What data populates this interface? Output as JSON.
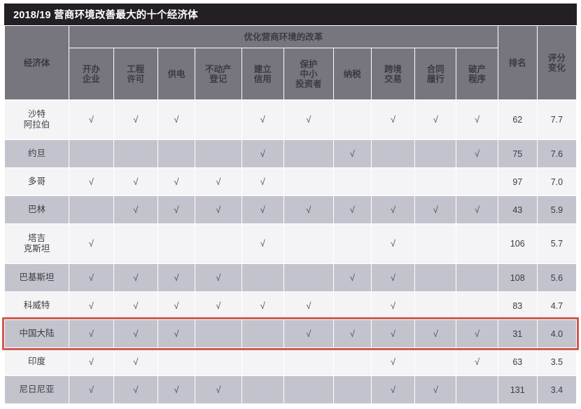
{
  "title": "2018/19 营商环境改善最大的十个经济体",
  "colors": {
    "title_bar_bg": "#231f25",
    "header_bg": "#77767f",
    "row_light_bg": "#f4f4f7",
    "row_dark_bg": "#c3c3cd",
    "highlight_border": "#cd5b52",
    "text": "#3b3b42"
  },
  "header": {
    "economy_label": "经济体",
    "reform_group_label": "优化营商环境的改革",
    "rank_label": "排名",
    "score_change_label": "评分\n变化",
    "score_change_line1": "评分",
    "score_change_line2": "变化",
    "reform_columns": [
      {
        "line1": "开办",
        "line2": "企业",
        "full": "开办企业"
      },
      {
        "line1": "工程",
        "line2": "许可",
        "full": "工程许可"
      },
      {
        "line1": "供电",
        "line2": "",
        "full": "供电"
      },
      {
        "line1": "不动产",
        "line2": "登记",
        "full": "不动产登记"
      },
      {
        "line1": "建立",
        "line2": "信用",
        "full": "建立信用"
      },
      {
        "line1": "保护",
        "line2": "中小",
        "line3": "投资者",
        "full": "保护中小投资者"
      },
      {
        "line1": "纳税",
        "line2": "",
        "full": "纳税"
      },
      {
        "line1": "跨境",
        "line2": "交易",
        "full": "跨境交易"
      },
      {
        "line1": "合同",
        "line2": "履行",
        "full": "合同履行"
      },
      {
        "line1": "破产",
        "line2": "程序",
        "full": "破产程序"
      }
    ]
  },
  "check_mark": "√",
  "rows": [
    {
      "name_lines": [
        "沙特",
        "阿拉伯"
      ],
      "name": "沙特阿拉伯",
      "reforms": [
        true,
        true,
        true,
        false,
        true,
        true,
        false,
        true,
        true,
        true
      ],
      "rank": "62",
      "score_change": "7.7",
      "shade": "light",
      "tall": true,
      "highlighted": false
    },
    {
      "name_lines": [
        "约旦"
      ],
      "name": "约旦",
      "reforms": [
        false,
        false,
        false,
        false,
        true,
        false,
        true,
        false,
        false,
        true
      ],
      "rank": "75",
      "score_change": "7.6",
      "shade": "dark",
      "tall": false,
      "highlighted": false
    },
    {
      "name_lines": [
        "多哥"
      ],
      "name": "多哥",
      "reforms": [
        true,
        true,
        true,
        true,
        true,
        false,
        false,
        false,
        false,
        false
      ],
      "rank": "97",
      "score_change": "7.0",
      "shade": "light",
      "tall": false,
      "highlighted": false
    },
    {
      "name_lines": [
        "巴林"
      ],
      "name": "巴林",
      "reforms": [
        false,
        true,
        true,
        true,
        true,
        true,
        true,
        true,
        true,
        true
      ],
      "rank": "43",
      "score_change": "5.9",
      "shade": "dark",
      "tall": false,
      "highlighted": false
    },
    {
      "name_lines": [
        "塔吉",
        "克斯坦"
      ],
      "name": "塔吉克斯坦",
      "reforms": [
        true,
        false,
        false,
        false,
        true,
        false,
        false,
        true,
        false,
        false
      ],
      "rank": "106",
      "score_change": "5.7",
      "shade": "light",
      "tall": true,
      "highlighted": false
    },
    {
      "name_lines": [
        "巴基斯坦"
      ],
      "name": "巴基斯坦",
      "reforms": [
        true,
        true,
        true,
        true,
        false,
        false,
        true,
        true,
        false,
        false
      ],
      "rank": "108",
      "score_change": "5.6",
      "shade": "dark",
      "tall": false,
      "highlighted": false
    },
    {
      "name_lines": [
        "科威特"
      ],
      "name": "科威特",
      "reforms": [
        true,
        true,
        true,
        true,
        true,
        true,
        false,
        true,
        false,
        false
      ],
      "rank": "83",
      "score_change": "4.7",
      "shade": "light",
      "tall": false,
      "highlighted": false
    },
    {
      "name_lines": [
        "中国大陆"
      ],
      "name": "中国大陆",
      "reforms": [
        true,
        true,
        true,
        false,
        false,
        true,
        true,
        true,
        true,
        true
      ],
      "rank": "31",
      "score_change": "4.0",
      "shade": "dark",
      "tall": false,
      "highlighted": true
    },
    {
      "name_lines": [
        "印度"
      ],
      "name": "印度",
      "reforms": [
        true,
        true,
        false,
        false,
        false,
        false,
        false,
        true,
        false,
        true
      ],
      "rank": "63",
      "score_change": "3.5",
      "shade": "light",
      "tall": false,
      "highlighted": false
    },
    {
      "name_lines": [
        "尼日尼亚"
      ],
      "name": "尼日尼亚",
      "reforms": [
        true,
        true,
        true,
        true,
        false,
        false,
        false,
        true,
        true,
        false
      ],
      "rank": "131",
      "score_change": "3.4",
      "shade": "dark",
      "tall": false,
      "highlighted": false
    }
  ]
}
